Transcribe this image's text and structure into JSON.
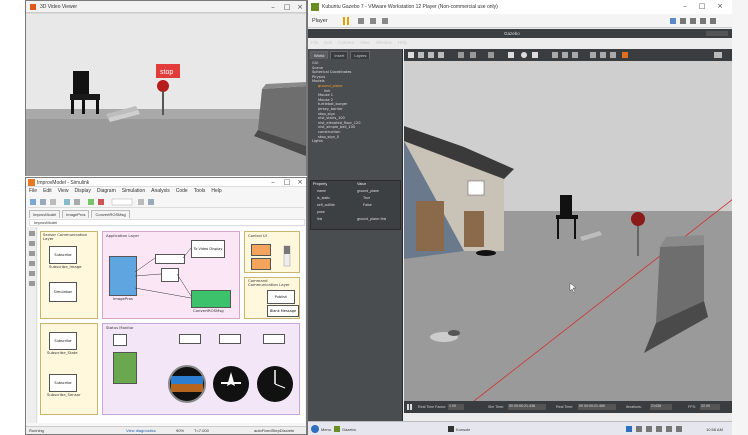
{
  "viewer": {
    "title": "3D Video Viewer"
  },
  "simulink": {
    "title": "ImprovModel - Simulink",
    "menu": [
      "File",
      "Edit",
      "View",
      "Display",
      "Diagram",
      "Simulation",
      "Analysis",
      "Code",
      "Tools",
      "Help"
    ],
    "tabs": [
      "ImprovModel",
      "ImagePros",
      "ConvertROSMsg"
    ],
    "breadcrumb": "ImprovModel",
    "sections": {
      "sensor": "Sensor Communication Layer",
      "app": "Application Layer",
      "control": "Control UI",
      "command": "Command Communication Layer",
      "status": "Status Monitor"
    },
    "blocks": {
      "subscribe": "Subscribe",
      "subscribe_image": "Subscribe_Image",
      "simulation_pace": "Simulation Pace",
      "ros": "ROS",
      "to_video": "To Video Display",
      "image_pros": "ImagePros",
      "convert": "ConvertROSMsg",
      "publish": "Publish",
      "blank_msg": "Blank Message",
      "subscribe_state": "Subscribe_State",
      "subscribe_sensor": "Subscribe_Sensor"
    },
    "status": {
      "left": "Running",
      "mid": "View diagnostics",
      "zoom": "90%",
      "time": "T=7.000",
      "solver": "autoFixedStepDiscrete"
    }
  },
  "vmware": {
    "title": "Kubuntu Gazebo 7 - VMware Workstation 12 Player (Non-commercial use only)",
    "player_label": "Player",
    "gazebo_title": "Gazebo",
    "menu": [
      "File",
      "Edit",
      "Camera",
      "View",
      "Window",
      "Help"
    ],
    "panel_tabs": [
      "World",
      "Insert",
      "Layers"
    ],
    "tree": [
      "GUI",
      "Scene",
      "Spherical Coordinates",
      "Physics",
      "Models",
      "ground_plane",
      "link",
      "Mouse 1",
      "Mouse 2",
      "turtlebot_burger",
      "jersey_barrier",
      "stop_sign",
      "nist_stairs_100",
      "nist_elevated_floor_120",
      "nist_simple_ball_100",
      "construction",
      "stop_sign_0",
      "Lights"
    ],
    "property_headers": [
      "Property",
      "Value"
    ],
    "properties": [
      {
        "name": "name",
        "value": "ground_plane"
      },
      {
        "name": "is_static",
        "value": "True"
      },
      {
        "name": "self_collide",
        "value": "False"
      },
      {
        "name": "pose",
        "value": ""
      },
      {
        "name": "link",
        "value": "ground_plane::link"
      }
    ],
    "bottom": {
      "real_time_factor_label": "Real Time Factor:",
      "real_time_factor": "1.00",
      "sim_time_label": "Sim Time:",
      "sim_time": "00 00:00:21.438",
      "real_time_label": "Real Time:",
      "real_time": "00 00:00:21.460",
      "iterations_label": "Iterations:",
      "iterations": "21438",
      "fps_label": "FPS:",
      "fps": "22.00"
    }
  },
  "taskbar": {
    "menu": "Menu",
    "apps": [
      "Gazebo",
      "Konsole"
    ],
    "clock": "10:58 AM"
  },
  "scene": {
    "sign_text": "stop"
  }
}
